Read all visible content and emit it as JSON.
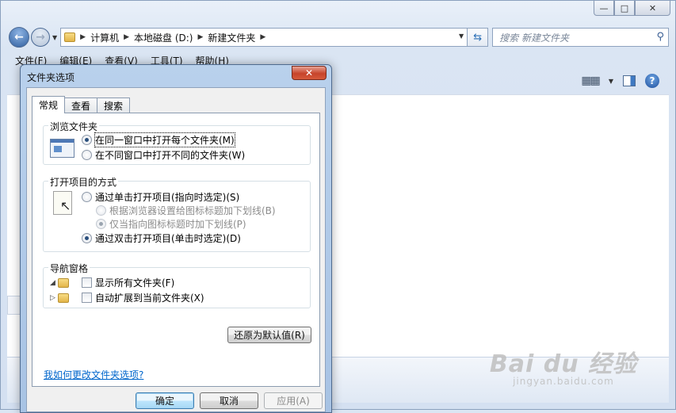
{
  "window": {
    "controls": {
      "minimize": "—",
      "maximize": "□",
      "close": "✕"
    }
  },
  "navigation": {
    "breadcrumb": [
      "计算机",
      "本地磁盘 (D:)",
      "新建文件夹"
    ],
    "search_placeholder": "搜索 新建文件夹",
    "icons": {
      "back": "back-arrow-icon",
      "forward": "forward-arrow-icon",
      "refresh": "refresh-icon",
      "search": "search-icon"
    }
  },
  "menubar": [
    "文件(F)",
    "编辑(E)",
    "查看(V)",
    "工具(T)",
    "帮助(H)"
  ],
  "dialog": {
    "title": "文件夹选项",
    "close": "✕",
    "tabs": [
      "常规",
      "查看",
      "搜索"
    ],
    "browse": {
      "title": "浏览文件夹",
      "options": [
        {
          "label": "在同一窗口中打开每个文件夹(M)",
          "selected": true
        },
        {
          "label": "在不同窗口中打开不同的文件夹(W)",
          "selected": false
        }
      ]
    },
    "click": {
      "title": "打开项目的方式",
      "single": "通过单击打开项目(指向时选定)(S)",
      "sub1": "根据浏览器设置给图标标题加下划线(B)",
      "sub2": "仅当指向图标标题时加下划线(P)",
      "double": "通过双击打开项目(单击时选定)(D)"
    },
    "navpane": {
      "title": "导航窗格",
      "show_all": "显示所有文件夹(F)",
      "auto_expand": "自动扩展到当前文件夹(X)"
    },
    "restore_defaults": "还原为默认值(R)",
    "help_link": "我如何更改文件夹选项?",
    "buttons": {
      "ok": "确定",
      "cancel": "取消",
      "apply": "应用(A)"
    }
  },
  "watermark": {
    "brand": "Bai du 经验",
    "url": "jingyan.baidu.com"
  }
}
